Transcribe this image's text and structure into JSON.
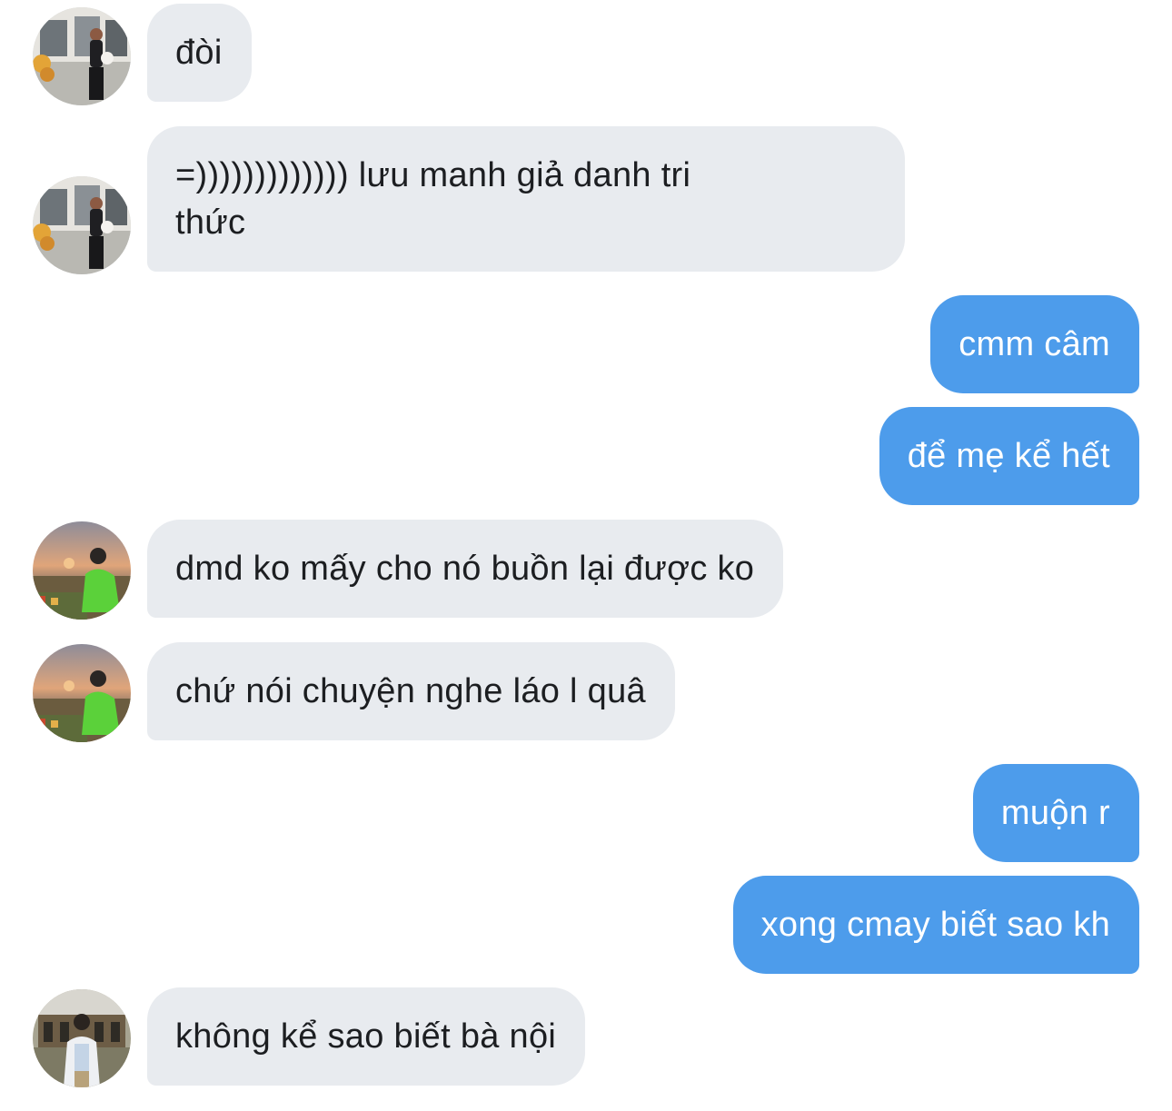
{
  "conversation": {
    "messages": [
      {
        "sender": "contact-a",
        "direction": "incoming",
        "text": "đòi"
      },
      {
        "sender": "contact-a",
        "direction": "incoming",
        "text": "=))))))))))))) lưu manh giả danh tri\nthức"
      },
      {
        "sender": "me",
        "direction": "outgoing",
        "text": "cmm câm"
      },
      {
        "sender": "me",
        "direction": "outgoing",
        "text": "để mẹ kể hết"
      },
      {
        "sender": "contact-b",
        "direction": "incoming",
        "text": "dmd ko mấy cho nó buồn lại được ko"
      },
      {
        "sender": "contact-b",
        "direction": "incoming",
        "text": "chứ nói chuyện nghe láo l quâ"
      },
      {
        "sender": "me",
        "direction": "outgoing",
        "text": "muộn r"
      },
      {
        "sender": "me",
        "direction": "outgoing",
        "text": "xong cmay biết sao kh"
      },
      {
        "sender": "contact-c",
        "direction": "incoming",
        "text": "không kể sao biết bà nội"
      }
    ]
  },
  "colors": {
    "incoming_bubble": "#e8ebef",
    "outgoing_bubble": "#4d9ceb",
    "incoming_text": "#1c1e21",
    "outgoing_text": "#ffffff",
    "background": "#ffffff"
  }
}
